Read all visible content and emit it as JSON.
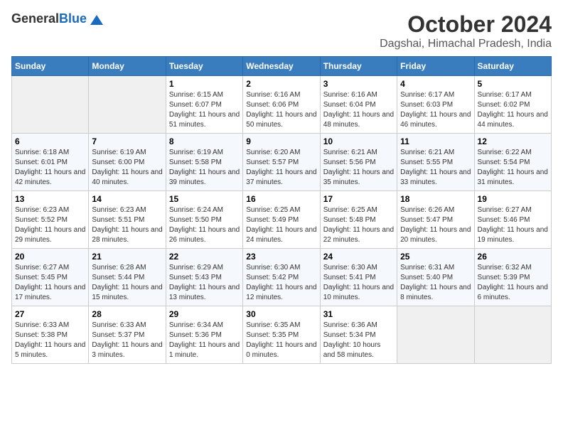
{
  "logo": {
    "general": "General",
    "blue": "Blue"
  },
  "title": "October 2024",
  "location": "Dagshai, Himachal Pradesh, India",
  "weekdays": [
    "Sunday",
    "Monday",
    "Tuesday",
    "Wednesday",
    "Thursday",
    "Friday",
    "Saturday"
  ],
  "weeks": [
    [
      {
        "day": null
      },
      {
        "day": null
      },
      {
        "day": "1",
        "sunrise": "Sunrise: 6:15 AM",
        "sunset": "Sunset: 6:07 PM",
        "daylight": "Daylight: 11 hours and 51 minutes."
      },
      {
        "day": "2",
        "sunrise": "Sunrise: 6:16 AM",
        "sunset": "Sunset: 6:06 PM",
        "daylight": "Daylight: 11 hours and 50 minutes."
      },
      {
        "day": "3",
        "sunrise": "Sunrise: 6:16 AM",
        "sunset": "Sunset: 6:04 PM",
        "daylight": "Daylight: 11 hours and 48 minutes."
      },
      {
        "day": "4",
        "sunrise": "Sunrise: 6:17 AM",
        "sunset": "Sunset: 6:03 PM",
        "daylight": "Daylight: 11 hours and 46 minutes."
      },
      {
        "day": "5",
        "sunrise": "Sunrise: 6:17 AM",
        "sunset": "Sunset: 6:02 PM",
        "daylight": "Daylight: 11 hours and 44 minutes."
      }
    ],
    [
      {
        "day": "6",
        "sunrise": "Sunrise: 6:18 AM",
        "sunset": "Sunset: 6:01 PM",
        "daylight": "Daylight: 11 hours and 42 minutes."
      },
      {
        "day": "7",
        "sunrise": "Sunrise: 6:19 AM",
        "sunset": "Sunset: 6:00 PM",
        "daylight": "Daylight: 11 hours and 40 minutes."
      },
      {
        "day": "8",
        "sunrise": "Sunrise: 6:19 AM",
        "sunset": "Sunset: 5:58 PM",
        "daylight": "Daylight: 11 hours and 39 minutes."
      },
      {
        "day": "9",
        "sunrise": "Sunrise: 6:20 AM",
        "sunset": "Sunset: 5:57 PM",
        "daylight": "Daylight: 11 hours and 37 minutes."
      },
      {
        "day": "10",
        "sunrise": "Sunrise: 6:21 AM",
        "sunset": "Sunset: 5:56 PM",
        "daylight": "Daylight: 11 hours and 35 minutes."
      },
      {
        "day": "11",
        "sunrise": "Sunrise: 6:21 AM",
        "sunset": "Sunset: 5:55 PM",
        "daylight": "Daylight: 11 hours and 33 minutes."
      },
      {
        "day": "12",
        "sunrise": "Sunrise: 6:22 AM",
        "sunset": "Sunset: 5:54 PM",
        "daylight": "Daylight: 11 hours and 31 minutes."
      }
    ],
    [
      {
        "day": "13",
        "sunrise": "Sunrise: 6:23 AM",
        "sunset": "Sunset: 5:52 PM",
        "daylight": "Daylight: 11 hours and 29 minutes."
      },
      {
        "day": "14",
        "sunrise": "Sunrise: 6:23 AM",
        "sunset": "Sunset: 5:51 PM",
        "daylight": "Daylight: 11 hours and 28 minutes."
      },
      {
        "day": "15",
        "sunrise": "Sunrise: 6:24 AM",
        "sunset": "Sunset: 5:50 PM",
        "daylight": "Daylight: 11 hours and 26 minutes."
      },
      {
        "day": "16",
        "sunrise": "Sunrise: 6:25 AM",
        "sunset": "Sunset: 5:49 PM",
        "daylight": "Daylight: 11 hours and 24 minutes."
      },
      {
        "day": "17",
        "sunrise": "Sunrise: 6:25 AM",
        "sunset": "Sunset: 5:48 PM",
        "daylight": "Daylight: 11 hours and 22 minutes."
      },
      {
        "day": "18",
        "sunrise": "Sunrise: 6:26 AM",
        "sunset": "Sunset: 5:47 PM",
        "daylight": "Daylight: 11 hours and 20 minutes."
      },
      {
        "day": "19",
        "sunrise": "Sunrise: 6:27 AM",
        "sunset": "Sunset: 5:46 PM",
        "daylight": "Daylight: 11 hours and 19 minutes."
      }
    ],
    [
      {
        "day": "20",
        "sunrise": "Sunrise: 6:27 AM",
        "sunset": "Sunset: 5:45 PM",
        "daylight": "Daylight: 11 hours and 17 minutes."
      },
      {
        "day": "21",
        "sunrise": "Sunrise: 6:28 AM",
        "sunset": "Sunset: 5:44 PM",
        "daylight": "Daylight: 11 hours and 15 minutes."
      },
      {
        "day": "22",
        "sunrise": "Sunrise: 6:29 AM",
        "sunset": "Sunset: 5:43 PM",
        "daylight": "Daylight: 11 hours and 13 minutes."
      },
      {
        "day": "23",
        "sunrise": "Sunrise: 6:30 AM",
        "sunset": "Sunset: 5:42 PM",
        "daylight": "Daylight: 11 hours and 12 minutes."
      },
      {
        "day": "24",
        "sunrise": "Sunrise: 6:30 AM",
        "sunset": "Sunset: 5:41 PM",
        "daylight": "Daylight: 11 hours and 10 minutes."
      },
      {
        "day": "25",
        "sunrise": "Sunrise: 6:31 AM",
        "sunset": "Sunset: 5:40 PM",
        "daylight": "Daylight: 11 hours and 8 minutes."
      },
      {
        "day": "26",
        "sunrise": "Sunrise: 6:32 AM",
        "sunset": "Sunset: 5:39 PM",
        "daylight": "Daylight: 11 hours and 6 minutes."
      }
    ],
    [
      {
        "day": "27",
        "sunrise": "Sunrise: 6:33 AM",
        "sunset": "Sunset: 5:38 PM",
        "daylight": "Daylight: 11 hours and 5 minutes."
      },
      {
        "day": "28",
        "sunrise": "Sunrise: 6:33 AM",
        "sunset": "Sunset: 5:37 PM",
        "daylight": "Daylight: 11 hours and 3 minutes."
      },
      {
        "day": "29",
        "sunrise": "Sunrise: 6:34 AM",
        "sunset": "Sunset: 5:36 PM",
        "daylight": "Daylight: 11 hours and 1 minute."
      },
      {
        "day": "30",
        "sunrise": "Sunrise: 6:35 AM",
        "sunset": "Sunset: 5:35 PM",
        "daylight": "Daylight: 11 hours and 0 minutes."
      },
      {
        "day": "31",
        "sunrise": "Sunrise: 6:36 AM",
        "sunset": "Sunset: 5:34 PM",
        "daylight": "Daylight: 10 hours and 58 minutes."
      },
      {
        "day": null
      },
      {
        "day": null
      }
    ]
  ]
}
